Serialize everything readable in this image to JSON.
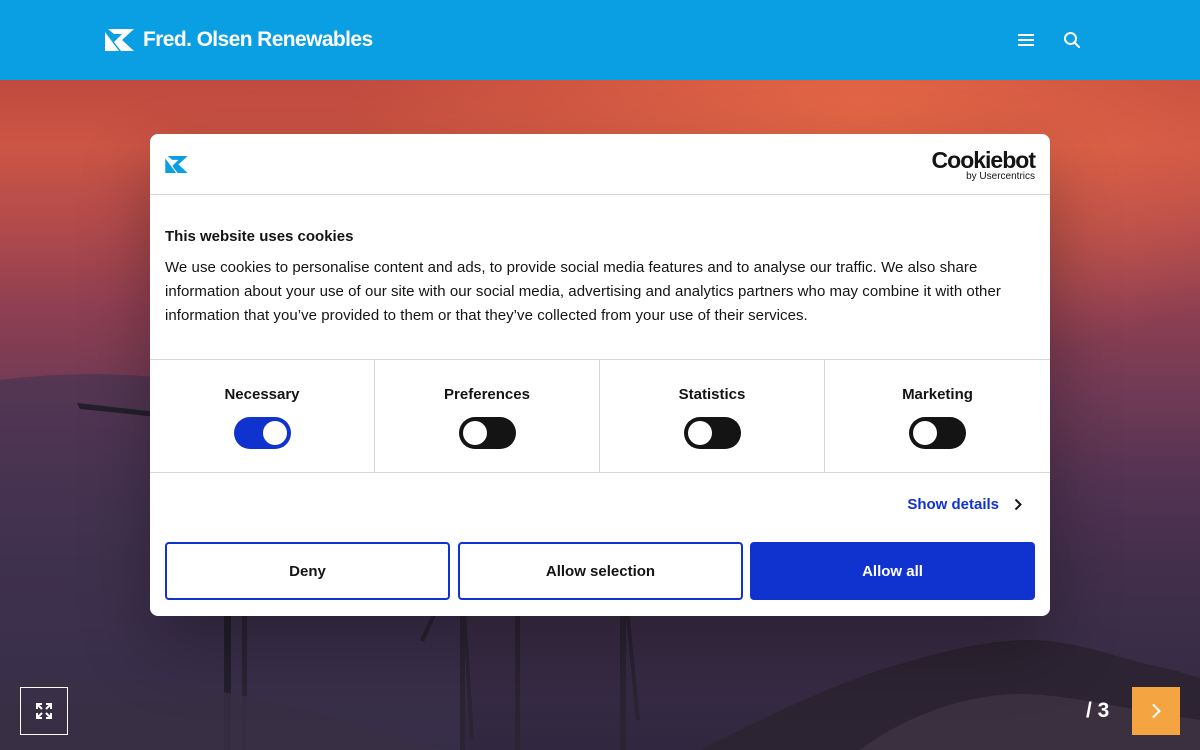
{
  "header": {
    "brand_name": "Fred. Olsen Renewables",
    "brand_icon": "fred-olsen-logo-icon",
    "menu_icon": "hamburger-menu-icon",
    "search_icon": "search-icon",
    "background_color": "#0a9ee3"
  },
  "cookie_banner": {
    "logo_icon": "fred-olsen-logo-icon",
    "provider_name": "Cookiebot",
    "provider_byline": "by Usercentrics",
    "title": "This website uses cookies",
    "description": "We use cookies to personalise content and ads, to provide social media features and to analyse our traffic. We also share information about your use of our site with our social media, advertising and analytics partners who may combine it with other information that you’ve provided to them or that they’ve collected from your use of their services.",
    "categories": [
      {
        "label": "Necessary",
        "enabled": true
      },
      {
        "label": "Preferences",
        "enabled": false
      },
      {
        "label": "Statistics",
        "enabled": false
      },
      {
        "label": "Marketing",
        "enabled": false
      }
    ],
    "show_details_label": "Show details",
    "buttons": {
      "deny": "Deny",
      "allow_selection": "Allow selection",
      "allow_all": "Allow all"
    },
    "accent_color": "#1032cf"
  },
  "slideshow": {
    "expand_icon": "expand-fullscreen-icon",
    "count_text": "/ 3",
    "next_icon": "chevron-right-icon",
    "next_button_color": "#f5a442"
  }
}
